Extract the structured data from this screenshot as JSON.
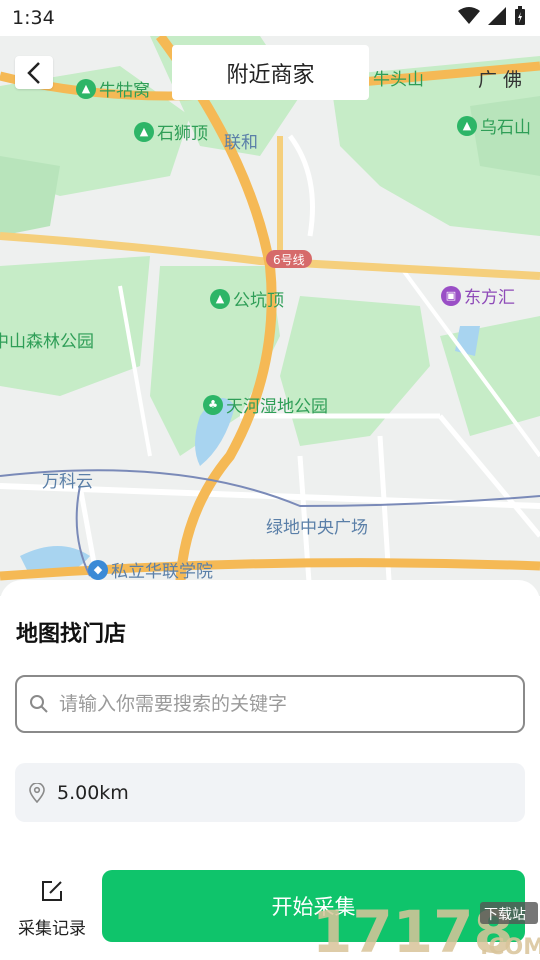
{
  "status": {
    "time": "1:34"
  },
  "header": {
    "title": "附近商家"
  },
  "map": {
    "pois": [
      {
        "name": "牛牯窝",
        "icon": "park-icon"
      },
      {
        "name": "石狮顶",
        "icon": "park-icon"
      },
      {
        "name": "乌石山",
        "icon": "park-icon"
      },
      {
        "name": "公坑顶",
        "icon": "park-icon"
      },
      {
        "name": "天河湿地公园",
        "icon": "park-icon"
      },
      {
        "name": "东方汇",
        "icon": "mall-icon"
      },
      {
        "name": "私立华联学院",
        "icon": "school-icon"
      }
    ],
    "labels": {
      "lianhe": "联和",
      "niutoushan": "牛头山",
      "guangfo": "广 佛",
      "forest_park": "中山森林公园",
      "wankeyun": "万科云",
      "lvdi": "绿地中央广场",
      "line6": "6号线"
    }
  },
  "panel": {
    "title": "地图找门店",
    "search_placeholder": "请输入你需要搜索的关键字",
    "distance": "5.00km",
    "records_label": "采集记录",
    "start_button": "开始采集"
  },
  "watermark": {
    "text": "17178",
    "sub": "下载站",
    "domain": ".COM"
  },
  "colors": {
    "accent": "#0fc46b",
    "park": "#2db567",
    "mall": "#9a4fc6",
    "road": "#f5b955"
  }
}
